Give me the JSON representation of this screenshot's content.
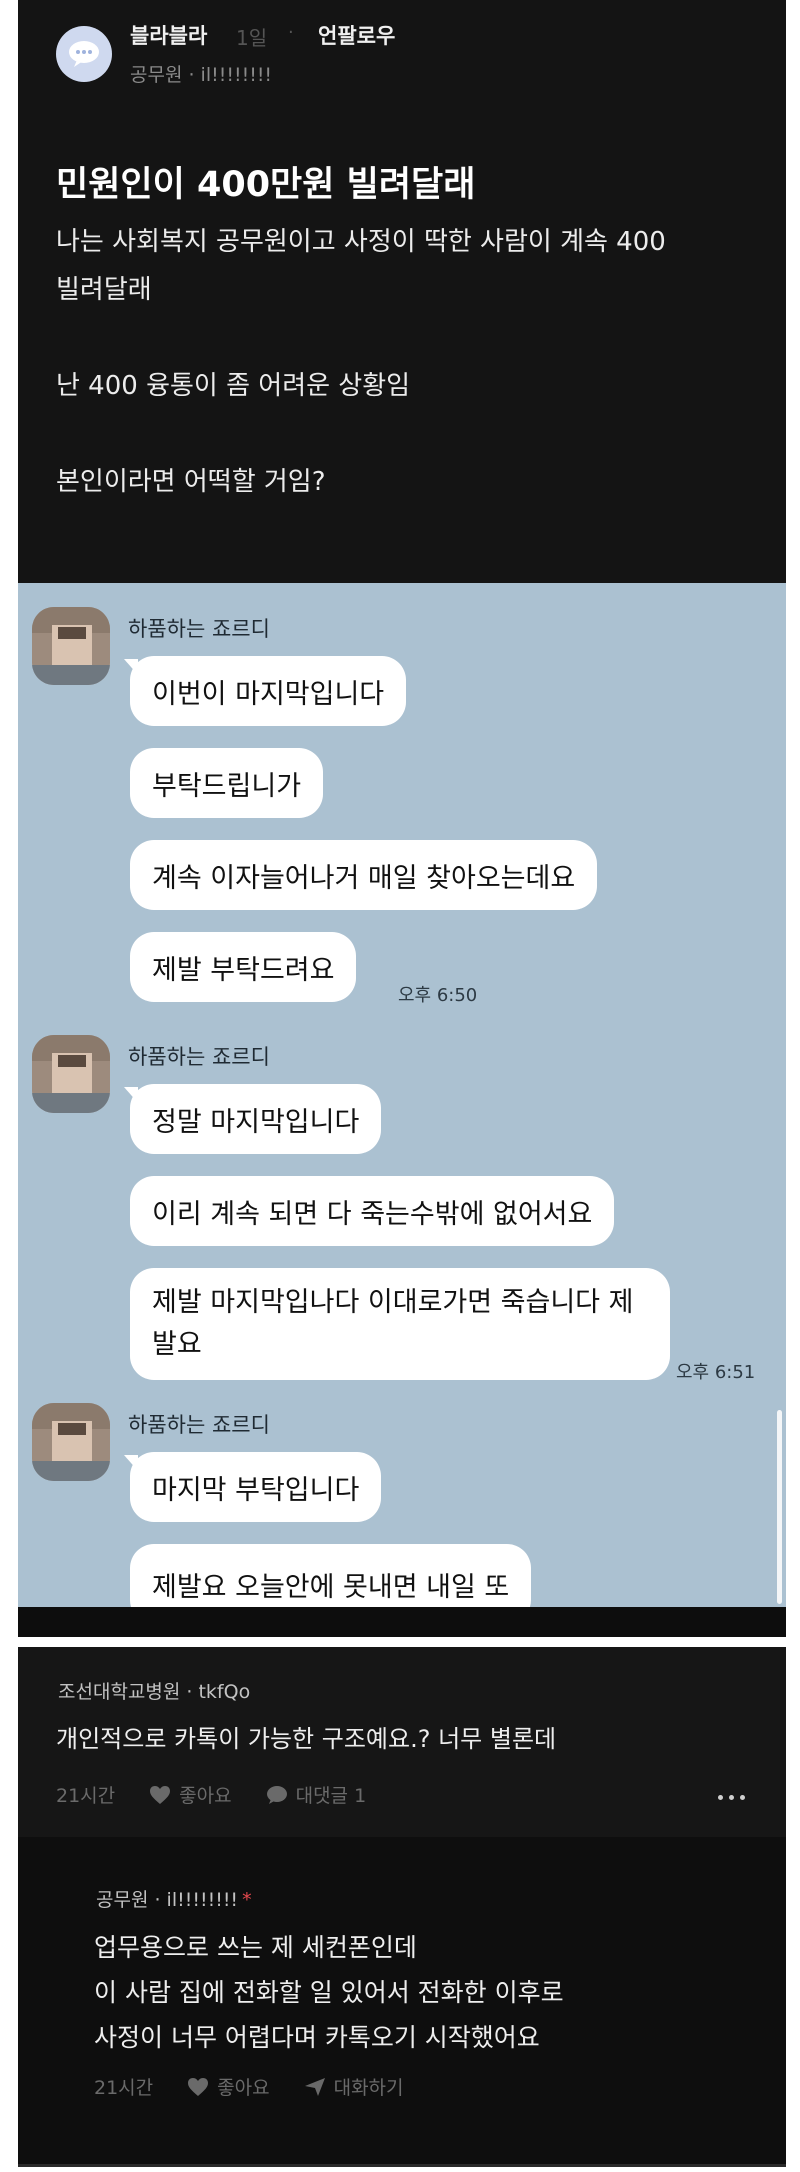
{
  "post": {
    "author": "블라블라",
    "time": "1일",
    "separator": "·",
    "follow_label": "언팔로우",
    "meta": "공무원 · il!!!!!!!!",
    "title": "민원인이 400만원 빌려달래",
    "body": [
      "나는 사회복지 공무원이고 사정이 딱한 사람이 계속 400",
      "빌려달래",
      "",
      "난 400 융통이 좀 어려운 상황임",
      "",
      "본인이라면 어떡할 거임?"
    ]
  },
  "chat": {
    "sender": "하품하는 죠르디",
    "messages": [
      "이번이 마지막입니다",
      "부탁드립니가",
      "계속 이자늘어나거 매일 찾아오는데요",
      "제발 부탁드려요",
      "정말 마지막입니다",
      "이리 계속 되면 다 죽는수밖에 없어서요",
      "제발 마지막입나다 이대로가면 죽습니다 제발요",
      "마지막 부탁입니다",
      "제발요 오늘안에 못내면 내일 또"
    ],
    "times": [
      "오후 6:50",
      "오후 6:51"
    ]
  },
  "comments": [
    {
      "author": "조선대학교병원 · tkfQo",
      "text": "개인적으로 카톡이 가능한 구조예요.? 너무 별론데",
      "time": "21시간",
      "like_label": "좋아요",
      "reply_label": "대댓글 1"
    },
    {
      "author": "공무원 · il!!!!!!!!",
      "badge": "*",
      "lines": [
        "업무용으로 쓰는 제 세컨폰인데",
        "이 사람 집에 전화할 일 있어서 전화한 이후로",
        "사정이 너무 어렵다며 카톡오기 시작했어요"
      ],
      "time": "21시간",
      "like_label": "좋아요",
      "chat_label": "대화하기"
    }
  ],
  "colors": {
    "post_bg": "#141414",
    "chat_bg": "#abc1d1",
    "bubble": "#ffffff",
    "comment_bg": "#161616"
  }
}
